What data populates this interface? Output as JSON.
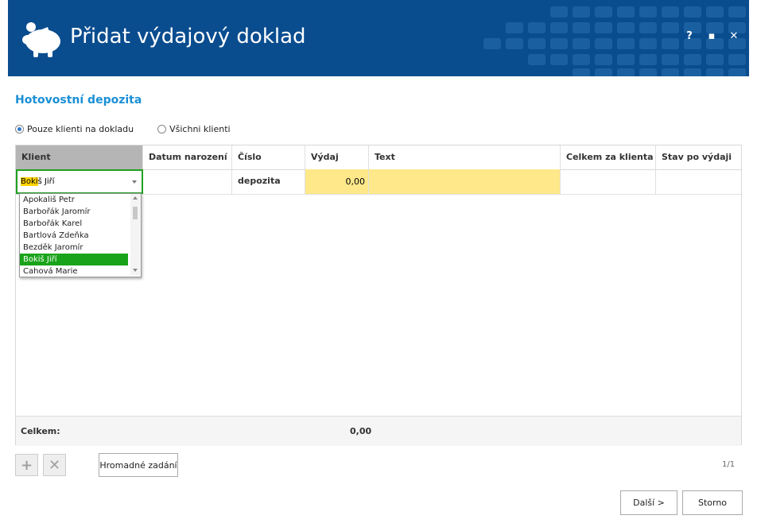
{
  "window": {
    "title": "Přidat výdajový doklad",
    "help_label": "?",
    "maximize_label": "▪",
    "close_label": "✕",
    "header_color": "#0a4d8f"
  },
  "section_title": "Hotovostní depozita",
  "filter": {
    "option1": "Pouze klienti na dokladu",
    "option2": "Všichni klienti",
    "selected": "Pouze klienti na dokladu"
  },
  "table": {
    "columns": [
      "Klient",
      "Datum narození",
      "Číslo depozita",
      "Výdaj",
      "Text",
      "Celkem za klienta",
      "Stav po výdaji"
    ],
    "row": {
      "klient_highlight": "Boki",
      "klient_rest": "š Jiří",
      "datum": "",
      "cislo": "",
      "vydaj": "0,00",
      "text": "",
      "celkem": "",
      "stav": ""
    },
    "footer": {
      "label": "Celkem:",
      "vydaj_total": "0,00"
    }
  },
  "dropdown": {
    "items": [
      "Apokališ Petr",
      "Barbořák Jaromír",
      "Barbořák Karel",
      "Bartlová Zdeňka",
      "Bezděk Jaromír",
      "Bokiš Jiří",
      "Cahová Marie"
    ],
    "selected": "Bokiš Jiří",
    "selected_color": "#19a31a"
  },
  "toolbar": {
    "add_icon": "plus-icon",
    "delete_icon": "x-icon",
    "bulk_label": "Hromadné zadání",
    "pager": "1/1"
  },
  "buttons": {
    "next": "Další >",
    "cancel": "Storno"
  }
}
